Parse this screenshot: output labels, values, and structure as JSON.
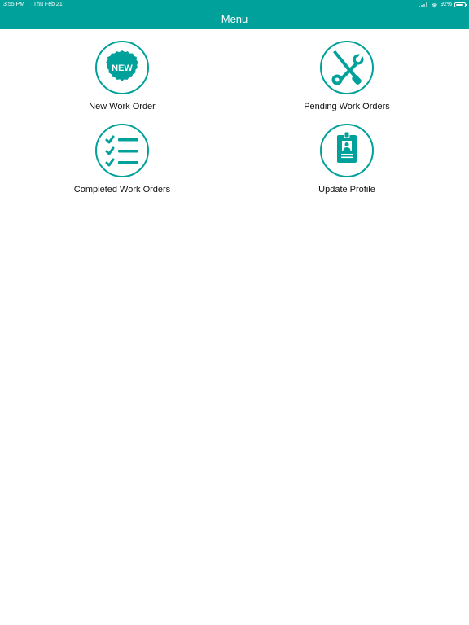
{
  "status_bar": {
    "time": "3:55 PM",
    "date": "Thu Feb 21",
    "battery_percent": "92%",
    "battery_level": 0.92,
    "icons": [
      "signal-icon",
      "wifi-icon",
      "battery-icon"
    ]
  },
  "header": {
    "title": "Menu",
    "background_color": "#00a19a"
  },
  "menu": {
    "accent_color": "#00a19a",
    "items": [
      {
        "label": "New Work Order",
        "icon": "new-badge-icon",
        "badge_text": "NEW"
      },
      {
        "label": "Pending Work Orders",
        "icon": "tools-icon"
      },
      {
        "label": "Completed Work Orders",
        "icon": "checklist-icon"
      },
      {
        "label": "Update Profile",
        "icon": "id-badge-icon"
      }
    ]
  }
}
